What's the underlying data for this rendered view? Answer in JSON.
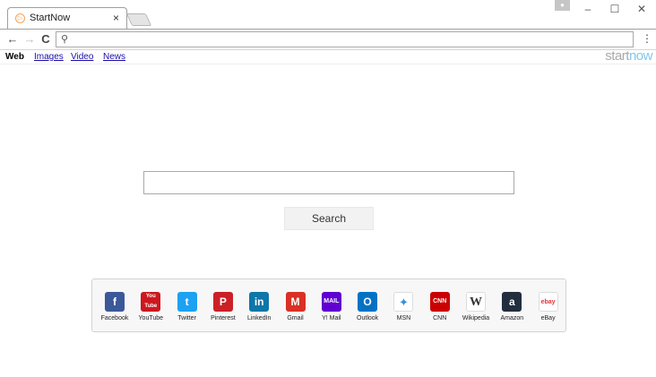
{
  "tab": {
    "title": "StartNow",
    "close_glyph": "×"
  },
  "window": {
    "minimize": "–",
    "maximize": "☐",
    "close": "✕"
  },
  "toolbar": {
    "back": "←",
    "forward": "→",
    "reload": "C",
    "menu": "⋮",
    "address_value": ""
  },
  "search_types": {
    "web": "Web",
    "images": "Images",
    "video": "Video",
    "news": "News"
  },
  "logo": {
    "start": "start",
    "now": "now"
  },
  "search": {
    "query": "",
    "button_label": "Search"
  },
  "shortcuts": [
    {
      "label": "Facebook",
      "glyph": "f",
      "color": "#3b5998"
    },
    {
      "label": "YouTube",
      "glyph": "You Tube",
      "color": "#cc181e"
    },
    {
      "label": "Twitter",
      "glyph": "t",
      "color": "#1da1f2"
    },
    {
      "label": "Pinterest",
      "glyph": "P",
      "color": "#cb2027"
    },
    {
      "label": "LinkedIn",
      "glyph": "in",
      "color": "#0e76a8"
    },
    {
      "label": "Gmail",
      "glyph": "M",
      "color": "#d93025"
    },
    {
      "label": "Y! Mail",
      "glyph": "MAIL",
      "color": "#6001d2"
    },
    {
      "label": "Outlook",
      "glyph": "O",
      "color": "#0072c6"
    },
    {
      "label": "MSN",
      "glyph": "✦",
      "color": "#ffffff"
    },
    {
      "label": "CNN",
      "glyph": "CNN",
      "color": "#cc0000"
    },
    {
      "label": "Wikipedia",
      "glyph": "W",
      "color": "#ffffff"
    },
    {
      "label": "Amazon",
      "glyph": "a",
      "color": "#232f3e"
    },
    {
      "label": "eBay",
      "glyph": "ebay",
      "color": "#ffffff"
    }
  ]
}
